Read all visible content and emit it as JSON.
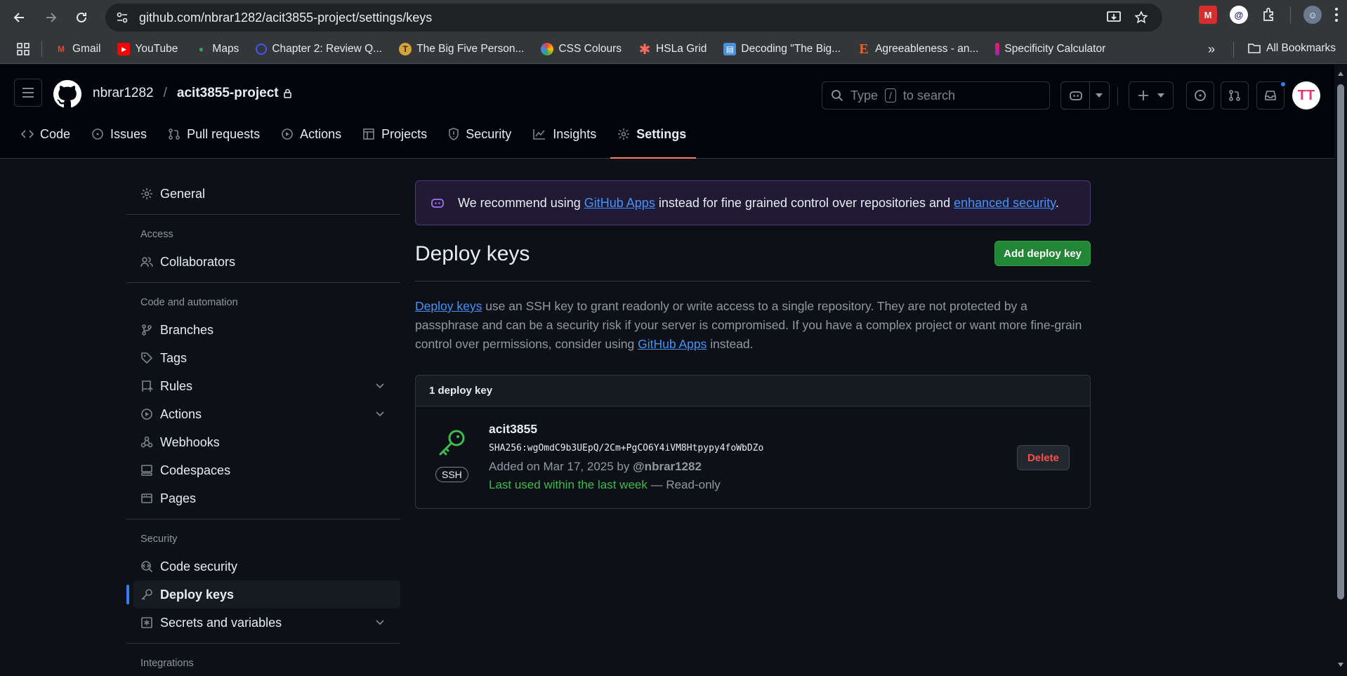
{
  "browser": {
    "url": "github.com/nbrar1282/acit3855-project/settings/keys",
    "bookmarks": [
      {
        "label": "Gmail",
        "icon": "gmail-icon"
      },
      {
        "label": "YouTube",
        "icon": "youtube-icon"
      },
      {
        "label": "Maps",
        "icon": "maps-icon"
      },
      {
        "label": "Chapter 2: Review Q...",
        "icon": "quizlet-icon"
      },
      {
        "label": "The Big Five Person...",
        "icon": "bigfive-icon"
      },
      {
        "label": "CSS Colours",
        "icon": "csscolours-icon"
      },
      {
        "label": "HSLa Grid",
        "icon": "asterisk-icon"
      },
      {
        "label": "Decoding \"The Big...",
        "icon": "decoding-icon"
      },
      {
        "label": "Agreeableness - an...",
        "icon": "etsy-e-icon"
      },
      {
        "label": "Specificity Calculator",
        "icon": "specificity-icon"
      }
    ],
    "all_bookmarks": "All Bookmarks"
  },
  "header": {
    "owner": "nbrar1282",
    "separator": "/",
    "repo": "acit3855-project",
    "search_prefix": "Type",
    "search_key": "/",
    "search_suffix": "to search",
    "avatar_initials": "TT"
  },
  "tabs": [
    {
      "label": "Code",
      "icon": "code-icon"
    },
    {
      "label": "Issues",
      "icon": "issue-icon"
    },
    {
      "label": "Pull requests",
      "icon": "pull-request-icon"
    },
    {
      "label": "Actions",
      "icon": "play-icon"
    },
    {
      "label": "Projects",
      "icon": "table-icon"
    },
    {
      "label": "Security",
      "icon": "shield-icon"
    },
    {
      "label": "Insights",
      "icon": "graph-icon"
    },
    {
      "label": "Settings",
      "icon": "gear-icon",
      "active": true
    }
  ],
  "sidebar": {
    "general": "General",
    "access_heading": "Access",
    "collaborators": "Collaborators",
    "code_heading": "Code and automation",
    "branches": "Branches",
    "tags": "Tags",
    "rules": "Rules",
    "actions": "Actions",
    "webhooks": "Webhooks",
    "codespaces": "Codespaces",
    "pages": "Pages",
    "security_heading": "Security",
    "code_security": "Code security",
    "deploy_keys": "Deploy keys",
    "secrets": "Secrets and variables",
    "integrations_heading": "Integrations"
  },
  "flash": {
    "pre": "We recommend using",
    "link1": "GitHub Apps",
    "mid": "instead for fine grained control over repositories and",
    "link2": "enhanced security",
    "post": "."
  },
  "main": {
    "title": "Deploy keys",
    "add_button": "Add deploy key",
    "desc_link": "Deploy keys",
    "desc_text": "use an SSH key to grant readonly or write access to a single repository. They are not protected by a passphrase and can be a security risk if your server is compromised. If you have a complex project or want more fine-grain control over permissions, consider using",
    "desc_link2": "GitHub Apps",
    "desc_end": "instead.",
    "count_label": "1 deploy key"
  },
  "key": {
    "name": "acit3855",
    "fingerprint": "SHA256:wgOmdC9b3UEpQ/2Cm+PgCO6Y4iVM8Htpypy4foWbDZo",
    "added_prefix": "Added on Mar 17, 2025 by",
    "added_by": "@nbrar1282",
    "last_used": "Last used within the last week",
    "access": "— Read-only",
    "type_badge": "SSH",
    "delete_button": "Delete"
  },
  "colors": {
    "accent": "#2f81f7",
    "primary_button": "#238636",
    "danger": "#f85149",
    "success": "#3fb950",
    "tab_underline": "#f78166"
  }
}
